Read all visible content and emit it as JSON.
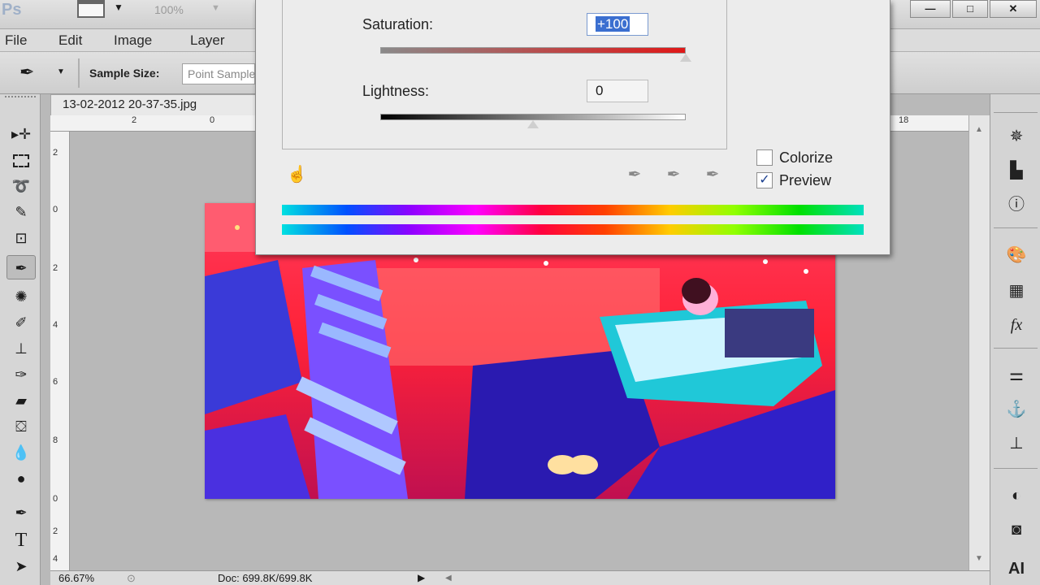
{
  "titlebar": {
    "logo": "Ps",
    "zoom": "100%",
    "win_minimize": "—",
    "win_maximize": "□",
    "win_close": "✕"
  },
  "menu": [
    "File",
    "Edit",
    "Image",
    "Layer"
  ],
  "options": {
    "sample_size_label": "Sample Size:",
    "sample_size_value": "Point Sample"
  },
  "document": {
    "tab_title": "13-02-2012 20-37-35.jpg",
    "ruler_h": [
      "2",
      "0",
      "18"
    ],
    "ruler_v": [
      "2",
      "0",
      "2",
      "4",
      "6",
      "8",
      "0",
      "2",
      "4"
    ]
  },
  "status": {
    "zoom": "66.67%",
    "doc": "Doc: 699.8K/699.8K"
  },
  "dialog": {
    "saturation_label": "Saturation:",
    "saturation_value": "+100",
    "saturation_level": 1.0,
    "lightness_label": "Lightness:",
    "lightness_value": "0",
    "lightness_level": 0.5,
    "colorize_label": "Colorize",
    "colorize_checked": false,
    "preview_label": "Preview",
    "preview_checked": true,
    "check_mark": "✓"
  },
  "colors": {
    "selection": "#3b6fd0",
    "saturation_track_start": "#8a8a8a",
    "saturation_track_end": "#e01818"
  }
}
